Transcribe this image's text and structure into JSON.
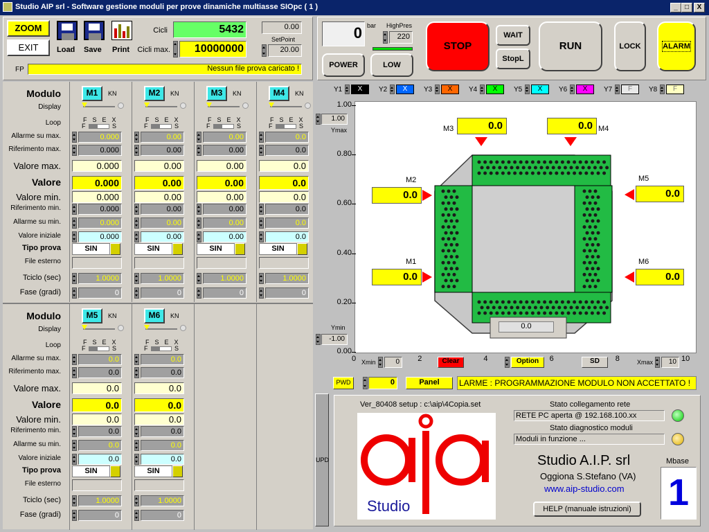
{
  "window": {
    "title": "Studio AIP srl  - Software gestione moduli per prove dinamiche multiasse SIOpc ( 1 )",
    "min": "_",
    "max": "□",
    "close": "X"
  },
  "toolbar": {
    "zoom": "ZOOM",
    "exit": "EXIT",
    "load": "Load",
    "save": "Save",
    "print": "Print",
    "cicli_label": "Cicli",
    "cicli_value": "5432",
    "cicli_max_label": "Cicli max.",
    "cicli_max_value": "10000000",
    "right_value": "0.00",
    "setpoint_label": "SetPoint",
    "setpoint_value": "20.00",
    "fp_label": "FP",
    "fp_message": "Nessun file prova caricato !"
  },
  "control": {
    "pressure": "0",
    "bar": "bar",
    "highpres_label": "HighPres",
    "highpres_value": "220",
    "stop": "STOP",
    "wait": "WAIT",
    "stopl": "StopL",
    "run": "RUN",
    "lock": "LOCK",
    "alarm": "ALARM",
    "power": "POWER",
    "low": "LOW"
  },
  "row_labels": {
    "modulo": "Modulo",
    "display": "Display",
    "loop": "Loop",
    "allarme_max": "Allarme su max.",
    "riferimento_max": "Riferimento max.",
    "valore_max": "Valore max.",
    "valore": "Valore",
    "valore_min": "Valore min.",
    "riferimento_min": "Riferimento min.",
    "allarme_min": "Allarme su min.",
    "valore_iniziale": "Valore iniziale",
    "tipo_prova": "Tipo prova",
    "file_esterno": "File esterno",
    "tciclo": "Tciclo (sec)",
    "fase": "Fase (gradi)"
  },
  "loop_marks": {
    "top": "F  S  E  X",
    "f": "F",
    "s": "S"
  },
  "unit": "KN",
  "modules": [
    {
      "name": "M1",
      "allarme_max": "0.000",
      "riferimento_max": "0.000",
      "valore_max": "0.000",
      "valore": "0.000",
      "valore_min": "0.000",
      "riferimento_min": "0.000",
      "allarme_min": "0.000",
      "valore_iniziale": "0.000",
      "tipo": "SIN",
      "tciclo": "1.0000",
      "fase": "0"
    },
    {
      "name": "M2",
      "allarme_max": "0.00",
      "riferimento_max": "0.00",
      "valore_max": "0.00",
      "valore": "0.00",
      "valore_min": "0.00",
      "riferimento_min": "0.00",
      "allarme_min": "0.00",
      "valore_iniziale": "0.00",
      "tipo": "SIN",
      "tciclo": "1.0000",
      "fase": "0"
    },
    {
      "name": "M3",
      "allarme_max": "0.00",
      "riferimento_max": "0.00",
      "valore_max": "0.00",
      "valore": "0.00",
      "valore_min": "0.00",
      "riferimento_min": "0.00",
      "allarme_min": "0.00",
      "valore_iniziale": "0.00",
      "tipo": "SIN",
      "tciclo": "1.0000",
      "fase": "0"
    },
    {
      "name": "M4",
      "allarme_max": "0.0",
      "riferimento_max": "0.0",
      "valore_max": "0.0",
      "valore": "0.0",
      "valore_min": "0.0",
      "riferimento_min": "0.0",
      "allarme_min": "0.0",
      "valore_iniziale": "0.0",
      "tipo": "SIN",
      "tciclo": "1.0000",
      "fase": "0"
    },
    {
      "name": "M5",
      "allarme_max": "0.0",
      "riferimento_max": "0.0",
      "valore_max": "0.0",
      "valore": "0.0",
      "valore_min": "0.0",
      "riferimento_min": "0.0",
      "allarme_min": "0.0",
      "valore_iniziale": "0.0",
      "tipo": "SIN",
      "tciclo": "1.0000",
      "fase": "0"
    },
    {
      "name": "M6",
      "allarme_max": "0.0",
      "riferimento_max": "0.0",
      "valore_max": "0.0",
      "valore": "0.0",
      "valore_min": "0.0",
      "riferimento_min": "0.0",
      "allarme_min": "0.0",
      "valore_iniziale": "0.0",
      "tipo": "SIN",
      "tciclo": "1.0000",
      "fase": "0"
    }
  ],
  "yseries": [
    {
      "label": "Y1",
      "value": "X",
      "bg": "#000000",
      "fg": "#ffffff"
    },
    {
      "label": "Y2",
      "value": "X",
      "bg": "#0066ff",
      "fg": "#ffffff"
    },
    {
      "label": "Y3",
      "value": "X",
      "bg": "#ff6600",
      "fg": "#000000"
    },
    {
      "label": "Y4",
      "value": "X",
      "bg": "#00ff00",
      "fg": "#000000"
    },
    {
      "label": "Y5",
      "value": "X",
      "bg": "#00ffff",
      "fg": "#000000"
    },
    {
      "label": "Y6",
      "value": "X",
      "bg": "#ff00ff",
      "fg": "#000000"
    },
    {
      "label": "Y7",
      "value": "F",
      "bg": "#e8e8e8",
      "fg": "#808080"
    },
    {
      "label": "Y8",
      "value": "F",
      "bg": "#ffffc0",
      "fg": "#808080"
    }
  ],
  "chart_data": {
    "type": "line",
    "yticks": [
      "1.00",
      "0.80",
      "0.60",
      "0.40",
      "0.20",
      "0.00"
    ],
    "xticks": [
      "0",
      "2",
      "4",
      "6",
      "8",
      "10"
    ],
    "ylim": [
      0,
      1
    ],
    "xlim": [
      0,
      10
    ],
    "ymax_label": "Ymax",
    "ymax_value": "1.00",
    "ymin_label": "Ymin",
    "ymin_value": "-1.00",
    "xmin_label": "Xmin",
    "xmin_value": "0",
    "xmax_label": "Xmax",
    "xmax_value": "10",
    "clear": "Clear",
    "option": "Option",
    "sd": "SD"
  },
  "diagram": {
    "m1": "M1",
    "m2": "M2",
    "m3": "M3",
    "m4": "M4",
    "m5": "M5",
    "m6": "M6",
    "v1": "0.0",
    "v2": "0.0",
    "v3": "0.0",
    "v4": "0.0",
    "v5": "0.0",
    "v6": "0.0",
    "bottom": "0.0"
  },
  "pwd": {
    "label": "PWD",
    "value": "0",
    "panel": "Panel",
    "message": "LARME : PROGRAMMAZIONE MODULO NON ACCETTATO !"
  },
  "info": {
    "upd": "UPD",
    "version": "Ver_80408 setup : c:\\aip\\4Copia.set",
    "rete_label": "Stato collegamento rete",
    "rete_value": "RETE PC aperta @ 192.168.100.xx",
    "diag_label": "Stato diagnostico moduli",
    "diag_value": "Moduli in funzione ...",
    "company": "Studio A.I.P. srl",
    "city": "Oggiona S.Stefano (VA)",
    "url": "www.aip-studio.com",
    "help": "HELP (manuale istruzioni)",
    "mbase_label": "Mbase",
    "mbase_value": "1",
    "logo_text": "aip",
    "logo_sub": "Studio"
  }
}
